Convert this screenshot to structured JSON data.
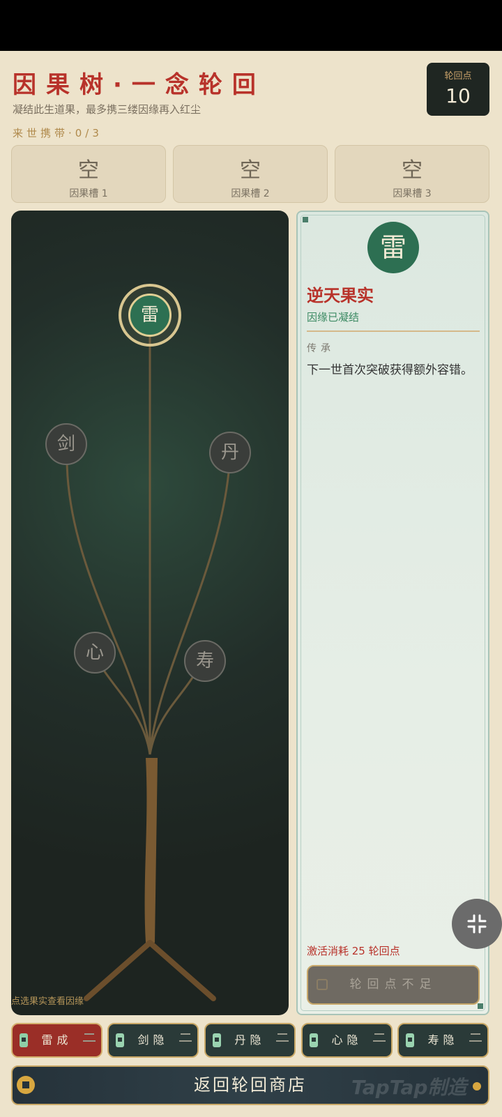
{
  "header": {
    "title": "因果树·一念轮回",
    "subtitle": "凝结此生道果，最多携三缕因缘再入红尘",
    "carry": "来世携带·0/3"
  },
  "points": {
    "label": "轮回点",
    "value": "10"
  },
  "slots": [
    {
      "main": "空",
      "sub": "因果槽 1"
    },
    {
      "main": "空",
      "sub": "因果槽 2"
    },
    {
      "main": "空",
      "sub": "因果槽 3"
    }
  ],
  "tree": {
    "hint": "点选果实查看因缘",
    "nodes": {
      "lei": "雷",
      "jian": "剑",
      "dan": "丹",
      "xin": "心",
      "shou": "寿"
    }
  },
  "detail": {
    "glyph": "雷",
    "name": "逆天果实",
    "status": "因缘已凝结",
    "section": "传承",
    "description": "下一世首次突破获得额外容错。",
    "cost": "激活消耗 25 轮回点",
    "button": "轮回点不足"
  },
  "tabs": [
    {
      "label": "雷成",
      "active": true
    },
    {
      "label": "剑隐",
      "active": false
    },
    {
      "label": "丹隐",
      "active": false
    },
    {
      "label": "心隐",
      "active": false
    },
    {
      "label": "寿隐",
      "active": false
    }
  ],
  "return_button": "返回轮回商店",
  "watermark": "TapTap制造",
  "icons": {
    "shrink": "collapse-icon",
    "lock": "lock-icon",
    "coin": "coin-icon"
  },
  "colors": {
    "accent_red": "#b8322a",
    "jade_green": "#2d7052",
    "gold": "#c9a866",
    "panel_dark": "#1d2420"
  }
}
